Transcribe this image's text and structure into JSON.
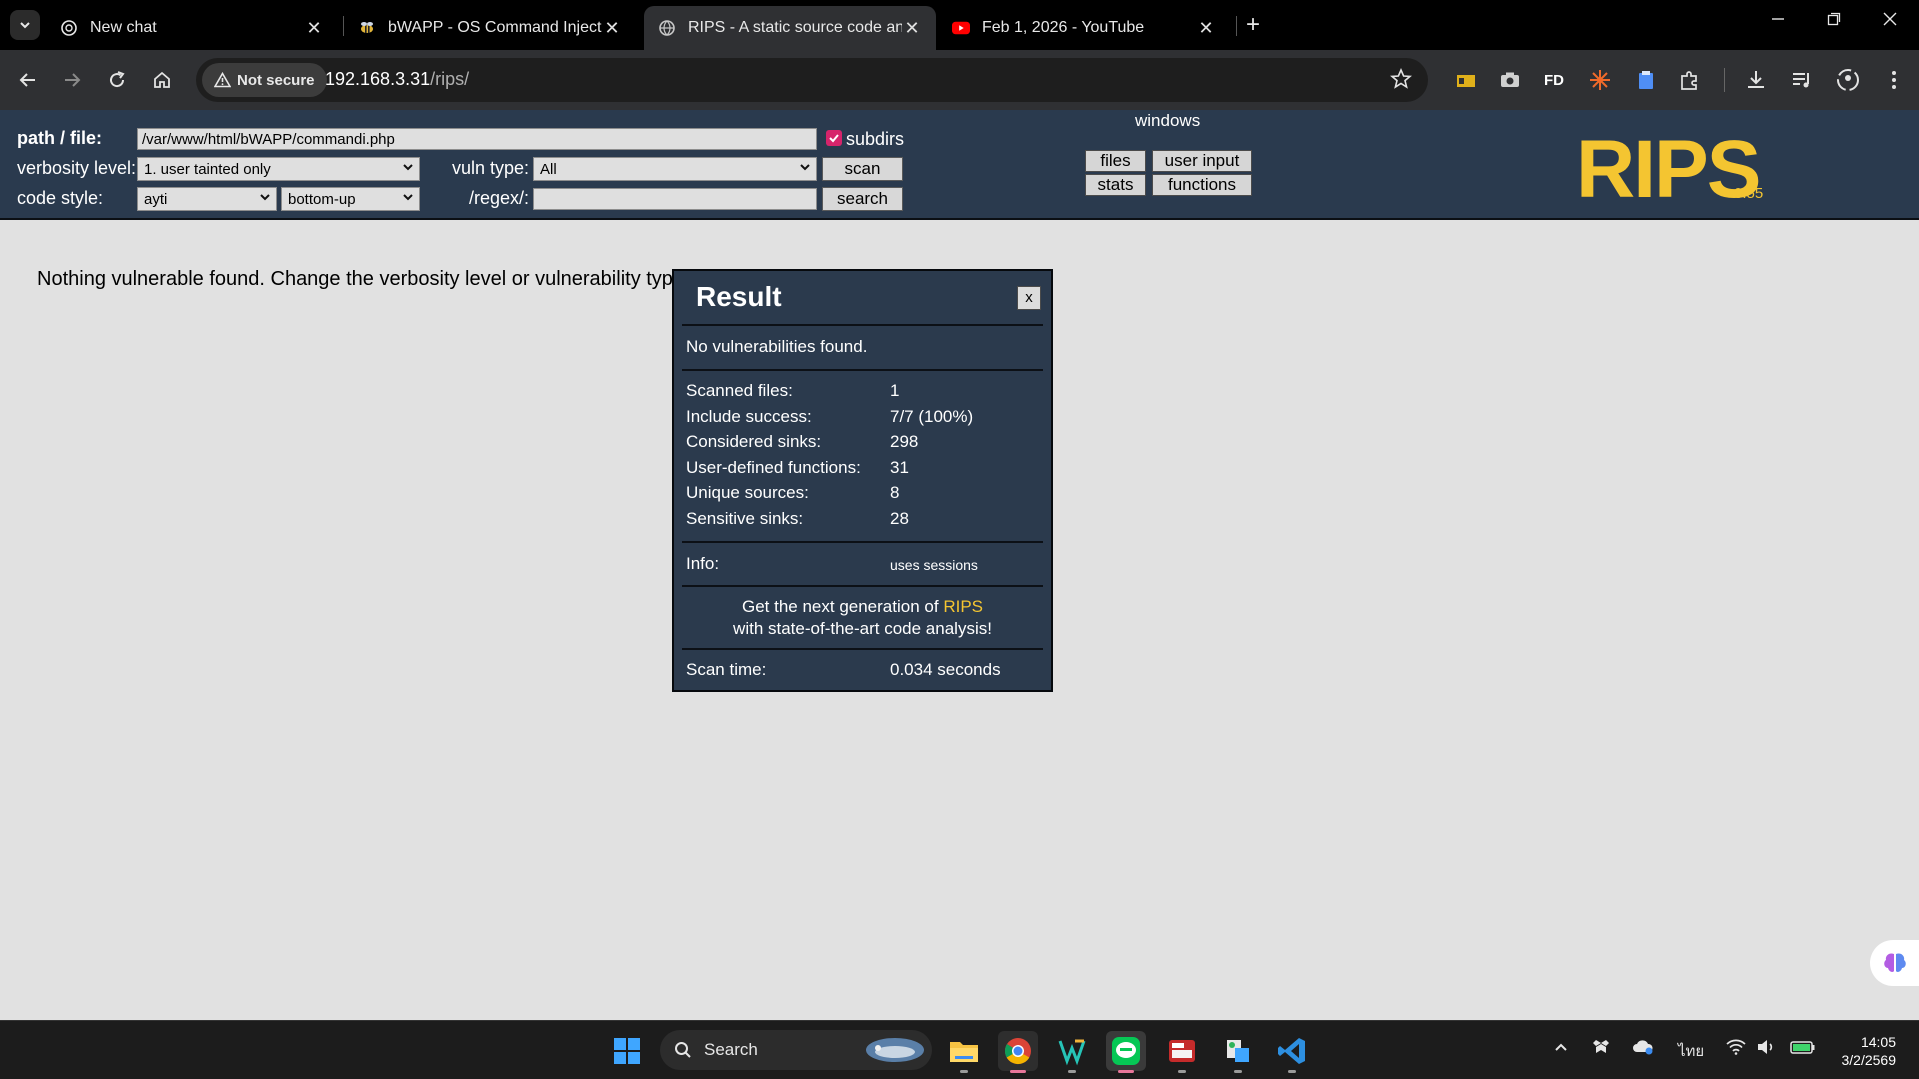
{
  "browser": {
    "tabs": [
      {
        "title": "New chat",
        "active": false
      },
      {
        "title": "bWAPP - OS Command Injectio",
        "active": false
      },
      {
        "title": "RIPS - A static source code anal",
        "active": true
      },
      {
        "title": "Feb 1, 2026 - YouTube",
        "active": false
      }
    ],
    "new_tab_label": "+",
    "security_chip": "Not secure",
    "url_host": "192.168.3.31",
    "url_path": "/rips/",
    "ext_fd_label": "FD"
  },
  "rips": {
    "path_label": "path / file:",
    "path_value": "/var/www/html/bWAPP/commandi.php",
    "subdirs_label": "subdirs",
    "verbosity_label": "verbosity level:",
    "verbosity_value": "1. user tainted only",
    "vuln_type_label": "vuln type:",
    "vuln_type_value": "All",
    "scan_button": "scan",
    "code_style_label": "code style:",
    "code_style_value": "ayti",
    "order_value": "bottom-up",
    "regex_label": "/regex/:",
    "search_button": "search",
    "windows_label": "windows",
    "menu_files": "files",
    "menu_user_input": "user input",
    "menu_stats": "stats",
    "menu_functions": "functions",
    "logo_text": "RIPS",
    "version": "0.55",
    "accent": "#f4c531"
  },
  "message": "Nothing vulnerable found. Change the verbosity level or vulnerability type and try again.",
  "result": {
    "title": "Result",
    "close_label": "x",
    "summary": "No vulnerabilities found.",
    "stats": [
      {
        "label": "Scanned files:",
        "value": "1"
      },
      {
        "label": "Include success:",
        "value": "7/7 (100%)"
      },
      {
        "label": "Considered sinks:",
        "value": "298"
      },
      {
        "label": "User-defined functions:",
        "value": "31"
      },
      {
        "label": "Unique sources:",
        "value": "8"
      },
      {
        "label": "Sensitive sinks:",
        "value": "28"
      }
    ],
    "info_label": "Info:",
    "info_value": "uses sessions",
    "promo_line1_prefix": "Get the next generation of",
    "promo_line1_link": "RIPS",
    "promo_line2": "with state-of-the-art code analysis!",
    "scan_time_label": "Scan time:",
    "scan_time_value": "0.034 seconds"
  },
  "taskbar": {
    "search_label": "Search",
    "lang": "ไทย",
    "time": "14:05",
    "date": "3/2/2569"
  }
}
